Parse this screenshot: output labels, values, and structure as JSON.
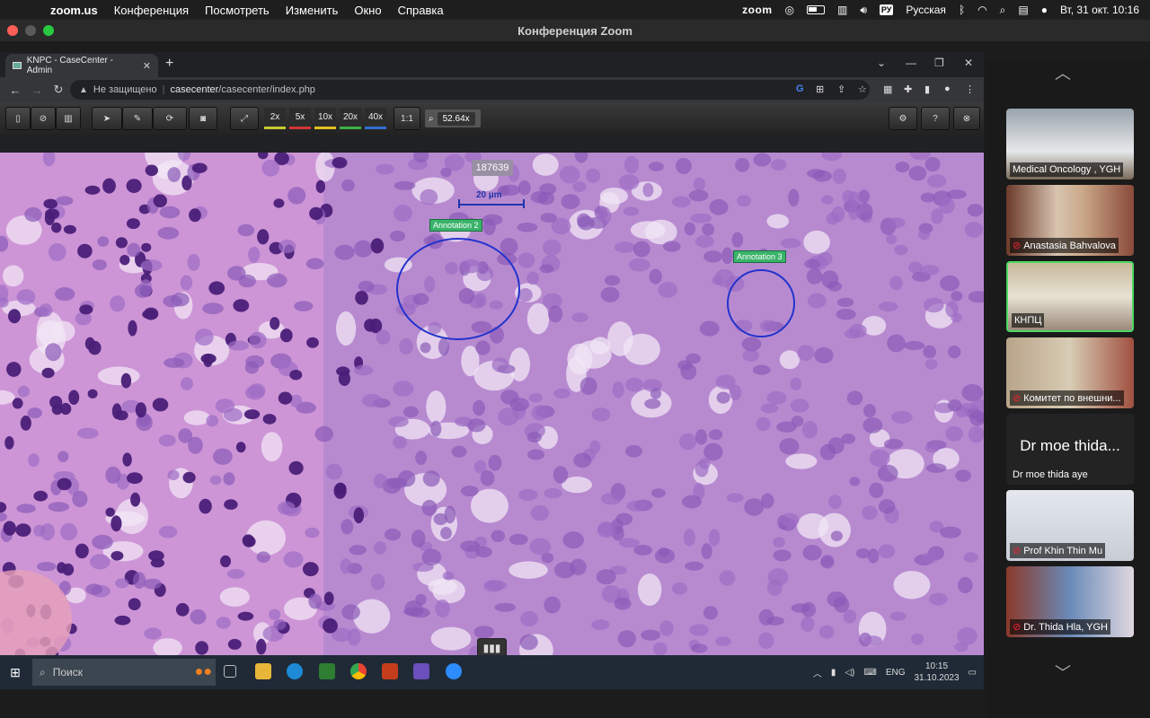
{
  "menubar": {
    "app_name": "zoom.us",
    "items": [
      "Конференция",
      "Посмотреть",
      "Изменить",
      "Окно",
      "Справка"
    ],
    "zoom_logo": "zoom",
    "keyboard_layout_badge": "РУ",
    "keyboard_layout": "Русская",
    "datetime": "Вт, 31 окт.  10:16"
  },
  "zoom_window": {
    "title": "Конференция Zoom"
  },
  "browser": {
    "tab_title": "KNPC - CaseCenter - Admin",
    "security_text": "Не защищено",
    "url_host": "casecenter",
    "url_path": "/casecenter/index.php"
  },
  "viewer": {
    "zoom_levels": [
      "2x",
      "5x",
      "10x",
      "20x",
      "40x"
    ],
    "one_to_one": "1:1",
    "zoom_value": "52.64x",
    "slide_id": "187639",
    "scale_label": "20 µm",
    "annotations": [
      {
        "label": "Annotation 2"
      },
      {
        "label": "Annotation 3"
      }
    ],
    "colors": {
      "tissue_background": "#b57ac8",
      "annotation_circle": "#2233cc",
      "annotation_label": "#3bb36b"
    }
  },
  "taskbar": {
    "search_placeholder": "Поиск",
    "language": "ENG",
    "time": "10:15",
    "date": "31.10.2023"
  },
  "participants": [
    {
      "name": "Medical Oncology , YGH",
      "muted": false
    },
    {
      "name": "Anastasia Bahvalova",
      "muted": true
    },
    {
      "name": "КНПЦ",
      "muted": false,
      "active": true
    },
    {
      "name": "Комитет по внешни...",
      "muted": true
    },
    {
      "name": "Dr moe thida aye",
      "display_large": "Dr moe thida...",
      "muted": false
    },
    {
      "name": "Prof Khin Thin Mu",
      "muted": true
    },
    {
      "name": "Dr. Thida Hla, YGH",
      "muted": true
    }
  ]
}
